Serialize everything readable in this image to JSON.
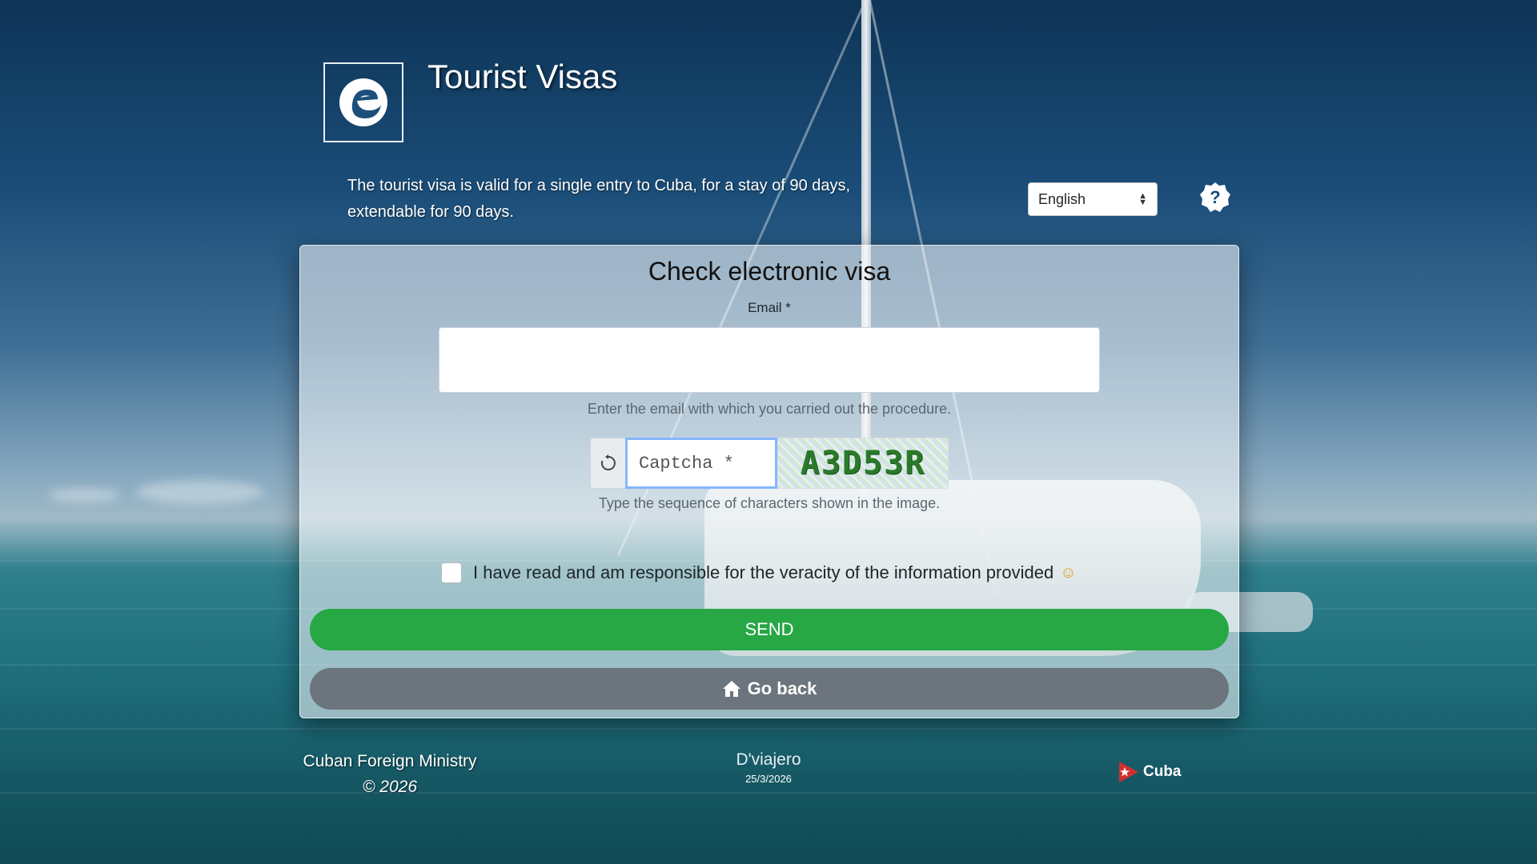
{
  "header": {
    "title": "Tourist Visas",
    "intro": "The tourist visa is valid for a single entry to Cuba, for a stay of 90 days, extendable for 90 days.",
    "language": "English",
    "logo_icon": "e-logo-icon",
    "help_icon": "question-badge-icon"
  },
  "form": {
    "title": "Check electronic visa",
    "email_label": "Email *",
    "email_value": "",
    "email_help": "Enter the email with which you carried out the procedure.",
    "captcha_placeholder": "Captcha *",
    "captcha_image_text": "A3D53R",
    "captcha_help": "Type the sequence of characters shown in the image.",
    "consent_label": "I have read and am responsible for the veracity of the information provided",
    "send_label": "SEND",
    "back_label": "Go back"
  },
  "footer": {
    "ministry": "Cuban Foreign Ministry",
    "copyright": "© 2026",
    "brand": "D'viajero",
    "date": "25/3/2026",
    "country": "Cuba"
  },
  "colors": {
    "send": "#28a745",
    "back": "#6c757d",
    "captcha_text": "#2b7a2b"
  }
}
